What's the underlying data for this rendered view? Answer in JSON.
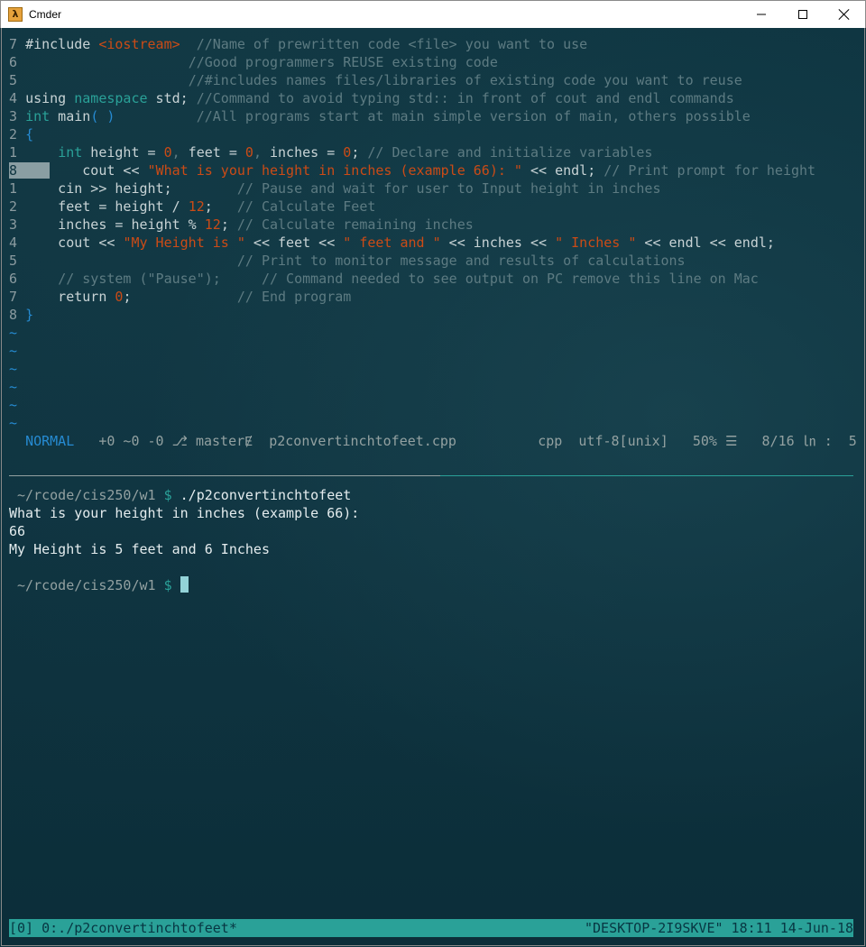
{
  "window": {
    "title": "Cmder",
    "icon": "lambda-icon",
    "icon_glyph": "λ"
  },
  "editor": {
    "lines": [
      {
        "num": "7",
        "segments": [
          {
            "t": "pl",
            "text": "#include "
          },
          {
            "t": "st",
            "text": "<iostream>"
          },
          {
            "t": "cm",
            "text": "  //Name of prewritten code <file> you want to use"
          }
        ]
      },
      {
        "num": "6",
        "segments": [
          {
            "t": "pl",
            "text": "                    "
          },
          {
            "t": "cm",
            "text": "//Good programmers REUSE existing code"
          }
        ]
      },
      {
        "num": "5",
        "segments": [
          {
            "t": "pl",
            "text": "                    "
          },
          {
            "t": "cm",
            "text": "//#includes names files/libraries of existing code you want to reuse"
          }
        ]
      },
      {
        "num": "4",
        "segments": [
          {
            "t": "pl",
            "text": "using "
          },
          {
            "t": "kw",
            "text": "namespace"
          },
          {
            "t": "pl",
            "text": " std; "
          },
          {
            "t": "cm",
            "text": "//Command to avoid typing std:: in front of cout and endl commands"
          }
        ]
      },
      {
        "num": "3",
        "segments": [
          {
            "t": "kw",
            "text": "int"
          },
          {
            "t": "pl",
            "text": " main"
          },
          {
            "t": "fn",
            "text": "( )"
          },
          {
            "t": "pl",
            "text": "          "
          },
          {
            "t": "cm",
            "text": "//All programs start at main simple version of main, others possible"
          }
        ]
      },
      {
        "num": "2",
        "segments": [
          {
            "t": "fn",
            "text": "{"
          }
        ]
      },
      {
        "num": "1",
        "segments": [
          {
            "t": "pl",
            "text": "    "
          },
          {
            "t": "kw",
            "text": "int"
          },
          {
            "t": "pl",
            "text": " height = "
          },
          {
            "t": "nm",
            "text": "0"
          },
          {
            "t": "cm",
            "text": ","
          },
          {
            "t": "pl",
            "text": " feet = "
          },
          {
            "t": "nm",
            "text": "0"
          },
          {
            "t": "cm",
            "text": ","
          },
          {
            "t": "pl",
            "text": " inches = "
          },
          {
            "t": "nm",
            "text": "0"
          },
          {
            "t": "pl",
            "text": "; "
          },
          {
            "t": "cm",
            "text": "// Declare and initialize variables"
          }
        ]
      },
      {
        "num": "8",
        "current": true,
        "segments": [
          {
            "t": "pl",
            "text": "    cout << "
          },
          {
            "t": "st",
            "text": "\"What is your height in inches (example 66): \""
          },
          {
            "t": "pl",
            "text": " << endl; "
          },
          {
            "t": "cm",
            "text": "// Print prompt for height"
          }
        ]
      },
      {
        "num": "1",
        "segments": [
          {
            "t": "pl",
            "text": "    cin >> height;        "
          },
          {
            "t": "cm",
            "text": "// Pause and wait for user to Input height in inches"
          }
        ]
      },
      {
        "num": "2",
        "segments": [
          {
            "t": "pl",
            "text": "    feet = height / "
          },
          {
            "t": "nm",
            "text": "12"
          },
          {
            "t": "pl",
            "text": ";   "
          },
          {
            "t": "cm",
            "text": "// Calculate Feet"
          }
        ]
      },
      {
        "num": "3",
        "segments": [
          {
            "t": "pl",
            "text": "    inches = height % "
          },
          {
            "t": "nm",
            "text": "12"
          },
          {
            "t": "pl",
            "text": "; "
          },
          {
            "t": "cm",
            "text": "// Calculate remaining inches"
          }
        ]
      },
      {
        "num": "4",
        "segments": [
          {
            "t": "pl",
            "text": "    cout << "
          },
          {
            "t": "st",
            "text": "\"My Height is \""
          },
          {
            "t": "pl",
            "text": " << feet << "
          },
          {
            "t": "st",
            "text": "\" feet and \""
          },
          {
            "t": "pl",
            "text": " << inches << "
          },
          {
            "t": "st",
            "text": "\" Inches \""
          },
          {
            "t": "pl",
            "text": " << endl << endl;"
          }
        ]
      },
      {
        "num": "5",
        "segments": [
          {
            "t": "pl",
            "text": "                          "
          },
          {
            "t": "cm",
            "text": "// Print to monitor message and results of calculations"
          }
        ]
      },
      {
        "num": "6",
        "segments": [
          {
            "t": "pl",
            "text": "    "
          },
          {
            "t": "cm",
            "text": "// system (\"Pause\");     // Command needed to see output on PC remove this line on Mac"
          }
        ]
      },
      {
        "num": "7",
        "segments": [
          {
            "t": "pl",
            "text": "    return "
          },
          {
            "t": "nm",
            "text": "0"
          },
          {
            "t": "pl",
            "text": ";             "
          },
          {
            "t": "cm",
            "text": "// End program"
          }
        ]
      },
      {
        "num": "8",
        "segments": [
          {
            "t": "fn",
            "text": "}"
          }
        ]
      }
    ],
    "tilde_lines": [
      "~",
      "~",
      "~",
      "~",
      "~",
      "~"
    ]
  },
  "statusline": {
    "mode": "NORMAL",
    "git_diff": "+0 ~0 -0",
    "branch_icon": "git-branch-icon",
    "branch_glyph": "⎇",
    "branch": "master",
    "readonly_glyph": "Ɇ",
    "filename": "p2convertinchtofeet.cpp",
    "filetype": "cpp",
    "encoding": "utf-8[unix]",
    "percent": "50% ☰",
    "position": "8/16 ㏑ :  5"
  },
  "terminal": {
    "prompt_path": "~/rcode/cis250/w1",
    "prompt_sign": "$",
    "command": "./p2convertinchtofeet",
    "output": [
      "What is your height in inches (example 66):",
      "66",
      "My Height is 5 feet and 6 Inches"
    ]
  },
  "tmux": {
    "left": "[0] 0:./p2convertinchtofeet*",
    "right": "\"DESKTOP-2I9SKVE\" 18:11 14-Jun-18"
  },
  "colors": {
    "accent": "#2aa198",
    "background": "#0e3440",
    "string": "#cb4b16",
    "function": "#268bd2"
  }
}
